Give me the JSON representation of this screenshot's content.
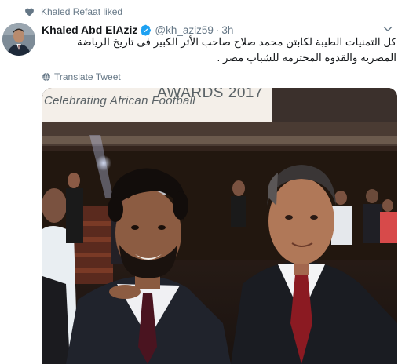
{
  "social_context": {
    "text": "Khaled Refaat liked"
  },
  "tweet": {
    "fullname": "Khaled Abd ElAziz",
    "username": "@kh_aziz59",
    "separator": "·",
    "time": "3h",
    "text": "كل التمنيات الطيبة لكابتن محمد صلاح صاحب الأثر الكبير فى تاريخ الرياضة المصرية والقدوة المحترمة للشباب مصر .",
    "translate_label": "Translate Tweet"
  },
  "photo": {
    "banner_awards": "AWARDS 2017",
    "banner_sub": "Celebrating African Football"
  },
  "colors": {
    "verified_blue": "#1da1f2",
    "secondary_text": "#657786",
    "banner_bg": "#f4efe9"
  },
  "icons": [
    "heart-icon",
    "verified-badge-icon",
    "chevron-down-icon",
    "globe-icon"
  ]
}
